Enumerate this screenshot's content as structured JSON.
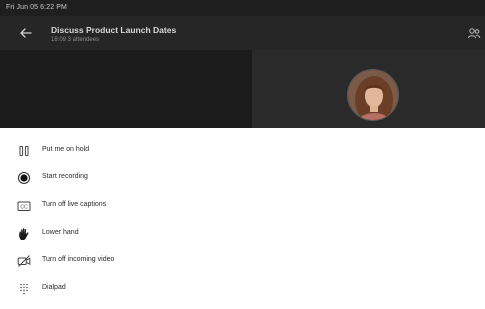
{
  "status_bar": {
    "datetime": "Fri Jun 05  6:22 PM"
  },
  "header": {
    "title": "Discuss Product Launch Dates",
    "subtitle": "18:09  3 attendees"
  },
  "icons": {
    "back": "back-arrow-icon",
    "participants": "participants-icon",
    "hold": "pause-icon",
    "record": "record-icon",
    "captions": "closed-captions-icon",
    "hand": "raised-hand-icon",
    "video_off": "video-off-icon",
    "dialpad": "dialpad-icon"
  },
  "menu": {
    "items": [
      {
        "label": "Put me on hold"
      },
      {
        "label": "Start recording"
      },
      {
        "label": "Turn off live captions"
      },
      {
        "label": "Lower hand"
      },
      {
        "label": "Turn off incoming video"
      },
      {
        "label": "Dialpad"
      }
    ]
  },
  "colors": {
    "call_background": "#1f1f1f",
    "header_background": "#262626",
    "menu_background": "#ffffff",
    "menu_text": "#2b2b2b"
  }
}
